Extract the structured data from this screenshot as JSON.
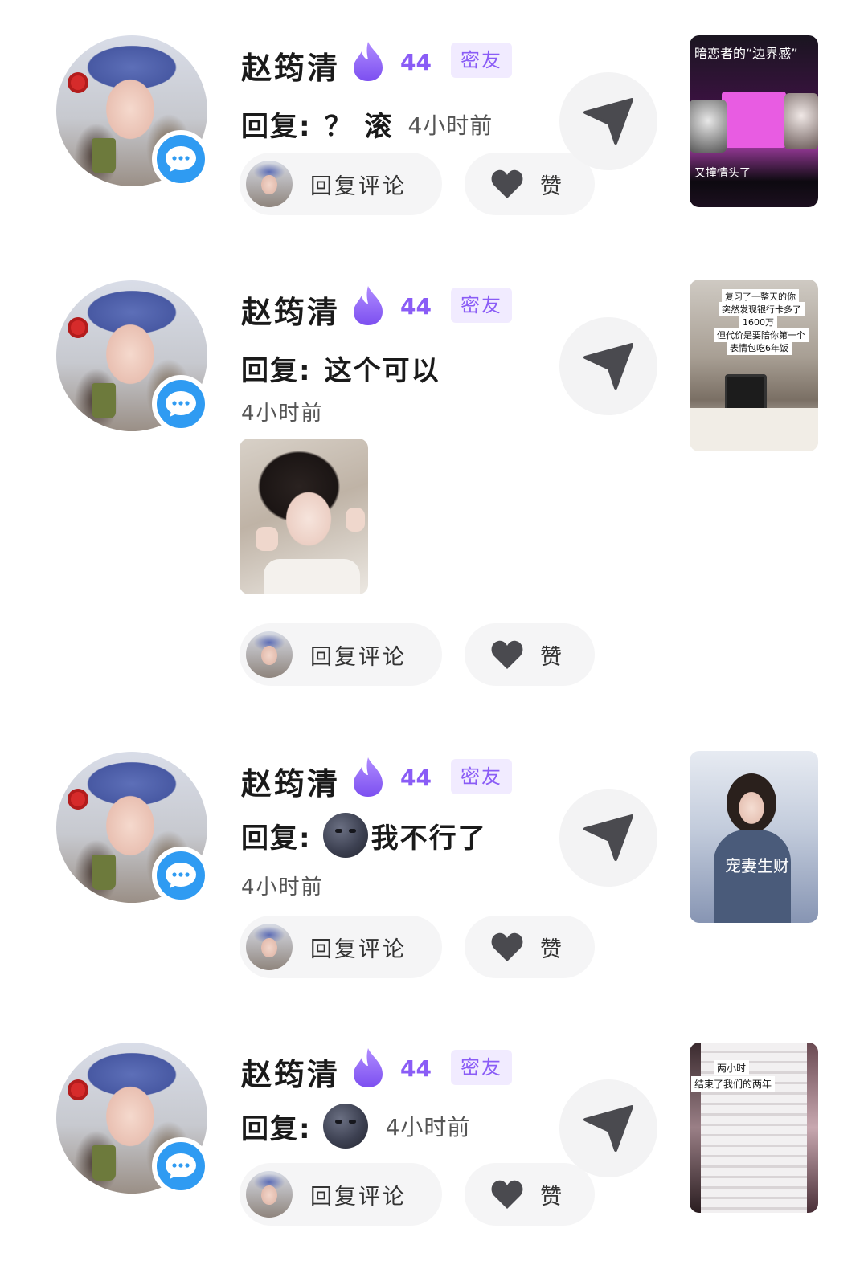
{
  "comments": [
    {
      "name": "赵筠清",
      "level": "44",
      "tag": "密友",
      "reply_prefix": "回复:",
      "reply_text": "？ 滚",
      "time": "4小时前",
      "reply_button": "回复评论",
      "like_label": "赞",
      "thumb_captions": [
        "暗恋者的“边界感”",
        "又撞情头了"
      ]
    },
    {
      "name": "赵筠清",
      "level": "44",
      "tag": "密友",
      "reply_prefix": "回复:",
      "reply_text": "这个可以",
      "time": "4小时前",
      "reply_button": "回复评论",
      "like_label": "赞",
      "thumb_captions": [
        "复习了一整天的你",
        "突然发现银行卡多了",
        "1600万",
        "但代价是要陪你第一个",
        "表情包吃6年饭"
      ]
    },
    {
      "name": "赵筠清",
      "level": "44",
      "tag": "密友",
      "reply_prefix": "回复:",
      "reply_text": "我不行了",
      "time": "4小时前",
      "reply_button": "回复评论",
      "like_label": "赞",
      "thumb_captions": [
        "宠妻生财"
      ]
    },
    {
      "name": "赵筠清",
      "level": "44",
      "tag": "密友",
      "reply_prefix": "回复:",
      "reply_text": "",
      "time": "4小时前",
      "reply_button": "回复评论",
      "like_label": "赞",
      "thumb_captions": [
        "两小时",
        "结束了我们的两年"
      ]
    }
  ],
  "colors": {
    "accent": "#8a5cf6",
    "tag_bg": "#f1ebff",
    "message_badge": "#2f9bf2",
    "pill_bg": "#f5f5f6",
    "icon_gray": "#4a4a4f"
  },
  "icons": {
    "level": "flame-icon",
    "message": "message-bubble-icon",
    "send": "send-arrow-icon",
    "like": "heart-icon",
    "emoji": "new-moon-face-emoji"
  }
}
